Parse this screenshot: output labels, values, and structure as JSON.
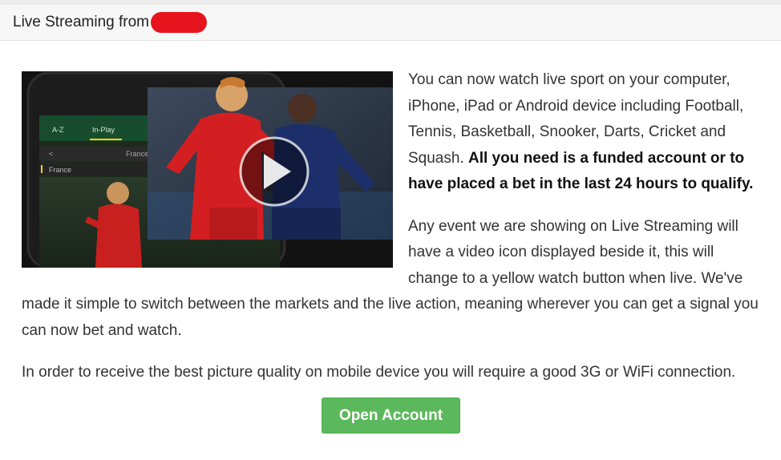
{
  "header": {
    "title": "Live Streaming from"
  },
  "media": {
    "app_tabs": [
      "A-Z",
      "In-Play"
    ],
    "app_row_label": "France",
    "app_row_label_2": "France",
    "play_icon": "play-icon"
  },
  "body": {
    "para1_text": "You can now watch live sport on your computer, iPhone, iPad or Android device including Football, Tennis, Basketball, Snooker, Darts, Cricket and Squash. ",
    "para1_bold": "All you need is a funded account or to have placed a bet in the last 24 hours to qualify.",
    "para2": "Any event we are showing on Live Streaming will have a video icon displayed beside it, this will change to a yellow watch button when live. We've made it simple to switch between the markets and the live action, meaning wherever you can get a signal you can now bet and watch.",
    "para3": "In order to receive the best picture quality on mobile device you will require a good 3G or WiFi connection."
  },
  "cta": {
    "label": "Open Account",
    "color": "#5cb85c"
  },
  "colors": {
    "redaction": "#e8141d",
    "header_bg": "#f7f7f7"
  }
}
